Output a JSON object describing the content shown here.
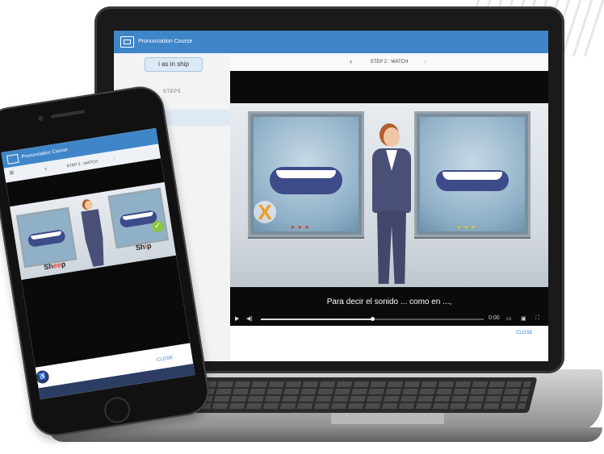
{
  "app": {
    "title": "Pronunciation Course",
    "lesson_button": "i as in ship",
    "steps_label": "STEPS",
    "step_nav": {
      "label": "STEP 2 : WATCH",
      "prev_icon": "‹",
      "next_icon": "›"
    },
    "video": {
      "subtitle": "Para decir el sonido ... como en ...,",
      "time": "0:00",
      "progress": 0.5
    },
    "close_label": "CLOSE"
  },
  "phone": {
    "title": "Pronunciation Course",
    "step_nav": {
      "label": "STEP 2 : WATCH",
      "prev_icon": "‹",
      "next_icon": "›",
      "menu_icon": "≡"
    },
    "word_left_prefix": "Sh",
    "word_left_highlight": "ee",
    "word_left_suffix": "p",
    "word_right_prefix": "Sh",
    "word_right_highlight": "i",
    "word_right_suffix": "p",
    "close_label": "CLOSE"
  },
  "colors": {
    "brand_blue": "#3f86c9",
    "wrong_orange": "#f29b1e",
    "correct_green": "#8cc63f",
    "highlight_red": "#e23b3b"
  }
}
